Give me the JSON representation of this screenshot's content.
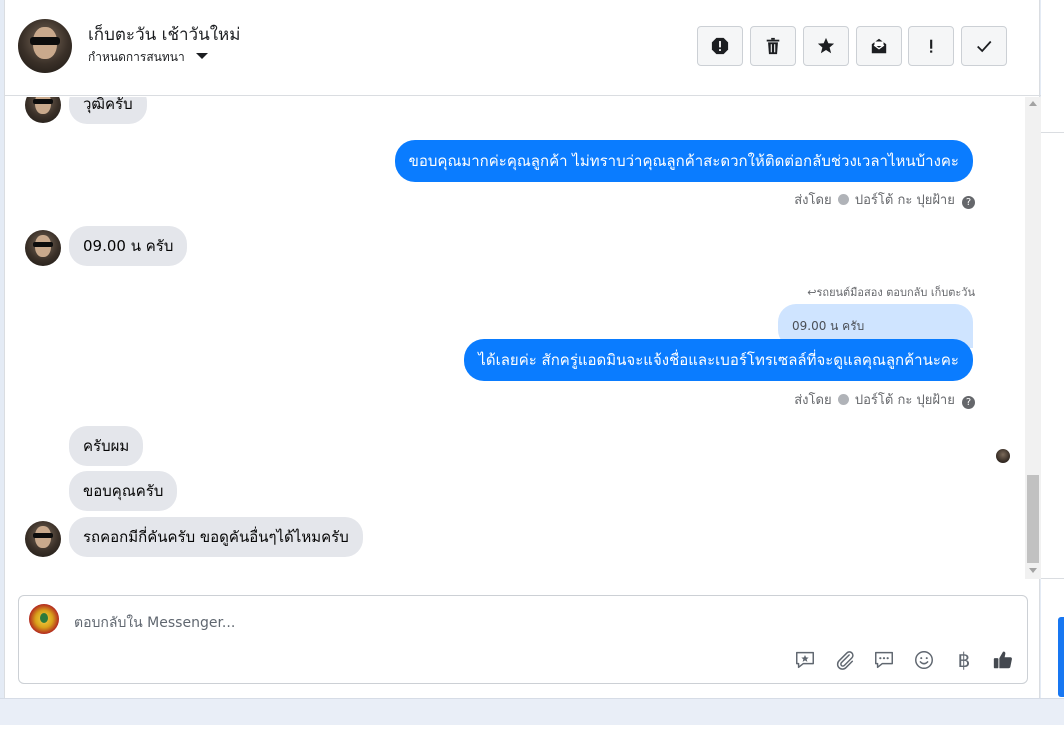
{
  "header": {
    "contact_name": "เก็บตะวัน เช้าวันใหม่",
    "assign_label": "กำหนดการสนทนา",
    "actions": [
      "spam-icon",
      "trash-icon",
      "star-icon",
      "envelope-icon",
      "flag-important-icon",
      "done-check-icon"
    ]
  },
  "messages": [
    {
      "dir": "in",
      "text": "วุฒิครับ",
      "avatar": true
    },
    {
      "dir": "out",
      "text": "ขอบคุณมากค่ะคุณลูกค้า ไม่ทราบว่าคุณลูกค้าสะดวกให้ติดต่อกลับช่วงเวลาไหนบ้างคะ",
      "sent_by": "ส่งโดย",
      "sender": "ปอร์โต้ กะ ปุยฝ้าย"
    },
    {
      "dir": "in",
      "text": "09.00 น ครับ",
      "avatar": true
    },
    {
      "dir": "out",
      "reply_hint": "รถยนต์มือสอง ตอบกลับ เก็บตะวัน",
      "quoted": "09.00 น ครับ",
      "text": "ได้เลยค่ะ สักครู่แอดมินจะแจ้งชื่อและเบอร์โทรเซลล์ที่จะดูแลคุณลูกค้านะคะ",
      "sent_by": "ส่งโดย",
      "sender": "ปอร์โต้ กะ ปุยฝ้าย"
    },
    {
      "dir": "in",
      "text": "ครับผม"
    },
    {
      "dir": "in",
      "text": "ขอบคุณครับ"
    },
    {
      "dir": "in",
      "text": "รถคอกมีกี่คันครับ ขอดูคันอื่นๆได้ไหมครับ",
      "avatar": true
    }
  ],
  "composer": {
    "placeholder": "ตอบกลับใน Messenger...",
    "tools": [
      "saved-reply-icon",
      "attachment-icon",
      "chat-bubble-icon",
      "emoji-icon",
      "baht-payment-icon",
      "thumbs-up-icon"
    ],
    "baht_symbol": "฿"
  },
  "colors": {
    "outgoing": "#0a7cff",
    "incoming": "#e4e6eb",
    "quoted": "#cfe4ff"
  }
}
